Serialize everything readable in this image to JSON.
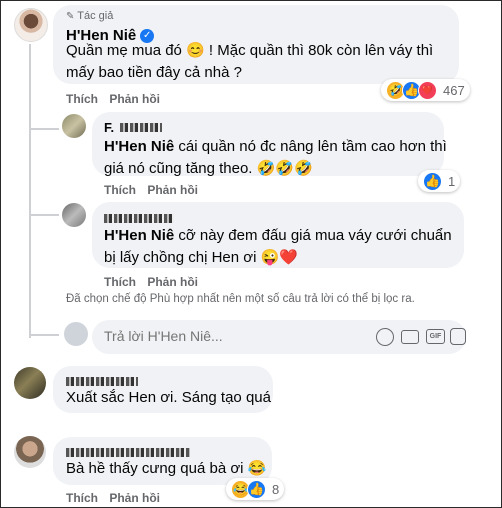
{
  "main_comment": {
    "author_tag": "Tác giả",
    "author": "H'Hen Niê",
    "text_line1": "Quần mẹ mua đó 😊 ! Mặc quần thì 80k còn lên váy thì",
    "text_line2": "mấy bao tiền đây cả nhà ?",
    "reaction_icons": [
      "🤣",
      "👍",
      "❤️"
    ],
    "reaction_count": "467",
    "like_label": "Thích",
    "reply_label": "Phản hồi"
  },
  "replies": [
    {
      "author_prefix": "F.",
      "mention": "H'Hen Niê",
      "text_line1": " cái quần nó đc nâng lên tầm cao hơn thì",
      "text_line2": "giá nó cũng tăng theo. 🤣🤣🤣",
      "reaction_icons": [
        "👍"
      ],
      "reaction_count": "1",
      "like_label": "Thích",
      "reply_label": "Phản hồi"
    },
    {
      "mention": "H'Hen Niê",
      "text_line1": " cỡ này đem đấu giá mua váy cưới chuẩn",
      "text_line2": "bị lấy chồng chị Hen ơi 😜❤️",
      "like_label": "Thích",
      "reply_label": "Phản hồi"
    }
  ],
  "filter_notice": "Đã chọn chế độ Phù hợp nhất nên một số câu trả lời có thể bị lọc ra.",
  "reply_input": {
    "placeholder": "Trả lời H'Hen Niê..."
  },
  "composer_icons": [
    "emoji-icon",
    "camera-icon",
    "gif-icon",
    "sticker-icon"
  ],
  "comments": [
    {
      "text": "Xuất sắc Hen ơi. Sáng tạo quá"
    },
    {
      "text": "Bà hề thấy cưng quá bà ơi 😂",
      "reaction_icons": [
        "😂",
        "👍"
      ],
      "reaction_count": "8",
      "like_label": "Thích",
      "reply_label": "Phản hồi"
    }
  ],
  "colors": {
    "bubble": "#f0f2f5",
    "verified": "#1877f2",
    "secondary_text": "#65676b",
    "heart": "#f33e58",
    "like_blue": "#1877f2"
  }
}
